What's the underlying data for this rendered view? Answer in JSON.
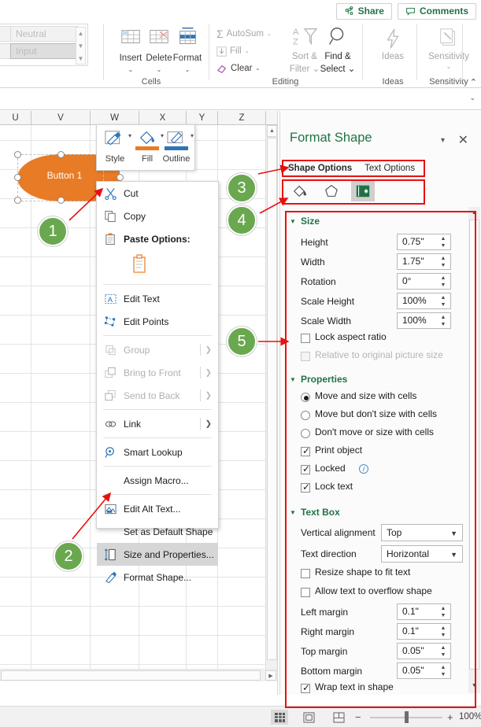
{
  "ribbon": {
    "share_label": "Share",
    "comments_label": "Comments",
    "styles": [
      {
        "name": "Neutral"
      },
      {
        "name": "Input"
      }
    ],
    "cells_group": {
      "label": "Cells",
      "items": [
        {
          "label": "Insert",
          "caret": "⌄"
        },
        {
          "label": "Delete",
          "caret": "⌄"
        },
        {
          "label": "Format",
          "caret": "⌄"
        }
      ]
    },
    "editing_group": {
      "label": "Editing",
      "items": [
        {
          "label": "AutoSum",
          "caret": "⌄",
          "enabled": false
        },
        {
          "label": "Fill",
          "caret": "⌄",
          "enabled": false
        },
        {
          "label": "Clear",
          "caret": "⌄",
          "enabled": true
        }
      ],
      "sort_filter": {
        "line1": "Sort &",
        "line2": "Filter ⌄"
      },
      "find_select": {
        "line1": "Find &",
        "line2": "Select ⌄"
      }
    },
    "ideas_group": {
      "label": "Ideas",
      "button": "Ideas"
    },
    "sensitivity_group": {
      "label": "Sensitivity",
      "button": "Sensitivity",
      "caret": "⌄"
    },
    "collapse": "⌃"
  },
  "formula_bar": {
    "value": "",
    "expand": "⌄"
  },
  "sheet": {
    "columns": [
      "U",
      "V",
      "W",
      "X",
      "Y",
      "Z"
    ],
    "shape": {
      "text": "Button 1"
    }
  },
  "mini_toolbar": {
    "items": [
      {
        "label": "Style",
        "icon": "shape-style-icon"
      },
      {
        "label": "Fill",
        "icon": "fill-bucket-icon"
      },
      {
        "label": "Outline",
        "icon": "outline-pen-icon"
      }
    ]
  },
  "context_menu": {
    "items": [
      {
        "label": "Cut",
        "icon": "scissors-icon",
        "state": "normal",
        "submenu": false
      },
      {
        "label": "Copy",
        "icon": "copy-icon",
        "state": "normal",
        "submenu": false
      },
      {
        "label": "Paste Options:",
        "icon": "paste-icon",
        "state": "bold",
        "submenu": false
      },
      {
        "label": "Edit Text",
        "icon": "edit-text-icon",
        "state": "normal",
        "submenu": false
      },
      {
        "label": "Edit Points",
        "icon": "edit-points-icon",
        "state": "normal",
        "submenu": false
      },
      {
        "label": "Group",
        "icon": "group-icon",
        "state": "disabled",
        "submenu": true
      },
      {
        "label": "Bring to Front",
        "icon": "bring-front-icon",
        "state": "disabled",
        "submenu": true
      },
      {
        "label": "Send to Back",
        "icon": "send-back-icon",
        "state": "disabled",
        "submenu": true
      },
      {
        "label": "Link",
        "icon": "link-icon",
        "state": "normal",
        "submenu": true
      },
      {
        "label": "Smart Lookup",
        "icon": "smart-lookup-icon",
        "state": "normal",
        "submenu": false
      },
      {
        "label": "Assign Macro...",
        "icon": "",
        "state": "normal",
        "submenu": false
      },
      {
        "label": "Edit Alt Text...",
        "icon": "alt-text-icon",
        "state": "normal",
        "submenu": false
      },
      {
        "label": "Set as Default Shape",
        "icon": "",
        "state": "normal",
        "submenu": false
      },
      {
        "label": "Size and Properties...",
        "icon": "size-properties-icon",
        "state": "highlighted",
        "submenu": false
      },
      {
        "label": "Format Shape...",
        "icon": "format-shape-icon",
        "state": "normal",
        "submenu": false
      }
    ]
  },
  "panel": {
    "title": "Format Shape",
    "dropdown_glyph": "▾",
    "close_glyph": "✕",
    "option_tabs": [
      {
        "label": "Shape Options",
        "selected": true
      },
      {
        "label": "Text Options",
        "selected": false
      }
    ],
    "icon_tabs": [
      {
        "name": "fill-line-icon",
        "selected": false
      },
      {
        "name": "effects-pentagon-icon",
        "selected": false
      },
      {
        "name": "size-properties-icon",
        "selected": true
      }
    ],
    "sections": {
      "size": {
        "title": "Size",
        "rows": [
          {
            "label": "Height",
            "value": "0.75\""
          },
          {
            "label": "Width",
            "value": "1.75\""
          },
          {
            "label": "Rotation",
            "value": "0°"
          },
          {
            "label": "Scale Height",
            "value": "100%"
          },
          {
            "label": "Scale Width",
            "value": "100%"
          }
        ],
        "checks": [
          {
            "label": "Lock aspect ratio",
            "checked": false,
            "disabled": false
          },
          {
            "label": "Relative to original picture size",
            "checked": false,
            "disabled": true
          }
        ]
      },
      "properties": {
        "title": "Properties",
        "radios": [
          {
            "label": "Move and size with cells",
            "selected": true
          },
          {
            "label": "Move but don't size with cells",
            "selected": false
          },
          {
            "label": "Don't move or size with cells",
            "selected": false
          }
        ],
        "checks": [
          {
            "label": "Print object",
            "checked": true,
            "info": false
          },
          {
            "label": "Locked",
            "checked": true,
            "info": true
          },
          {
            "label": "Lock text",
            "checked": true,
            "info": false
          }
        ]
      },
      "text_box": {
        "title": "Text Box",
        "combos": [
          {
            "label": "Vertical alignment",
            "value": "Top"
          },
          {
            "label": "Text direction",
            "value": "Horizontal"
          }
        ],
        "checks_top": [
          {
            "label": "Resize shape to fit text",
            "checked": false
          },
          {
            "label": "Allow text to overflow shape",
            "checked": false
          }
        ],
        "margins": [
          {
            "label": "Left margin",
            "value": "0.1\""
          },
          {
            "label": "Right margin",
            "value": "0.1\""
          },
          {
            "label": "Top margin",
            "value": "0.05\""
          },
          {
            "label": "Bottom margin",
            "value": "0.05\""
          }
        ],
        "checks_bottom": [
          {
            "label": "Wrap text in shape",
            "checked": true
          }
        ]
      }
    }
  },
  "status_bar": {
    "views": [
      {
        "name": "normal-view-icon",
        "selected": true
      },
      {
        "name": "page-layout-icon",
        "selected": false
      },
      {
        "name": "page-break-preview-icon",
        "selected": false
      }
    ],
    "zoom_out": "−",
    "zoom_in": "+",
    "zoom_level": "100%"
  },
  "callouts": [
    {
      "number": "1"
    },
    {
      "number": "2"
    },
    {
      "number": "3"
    },
    {
      "number": "4"
    },
    {
      "number": "5"
    }
  ]
}
